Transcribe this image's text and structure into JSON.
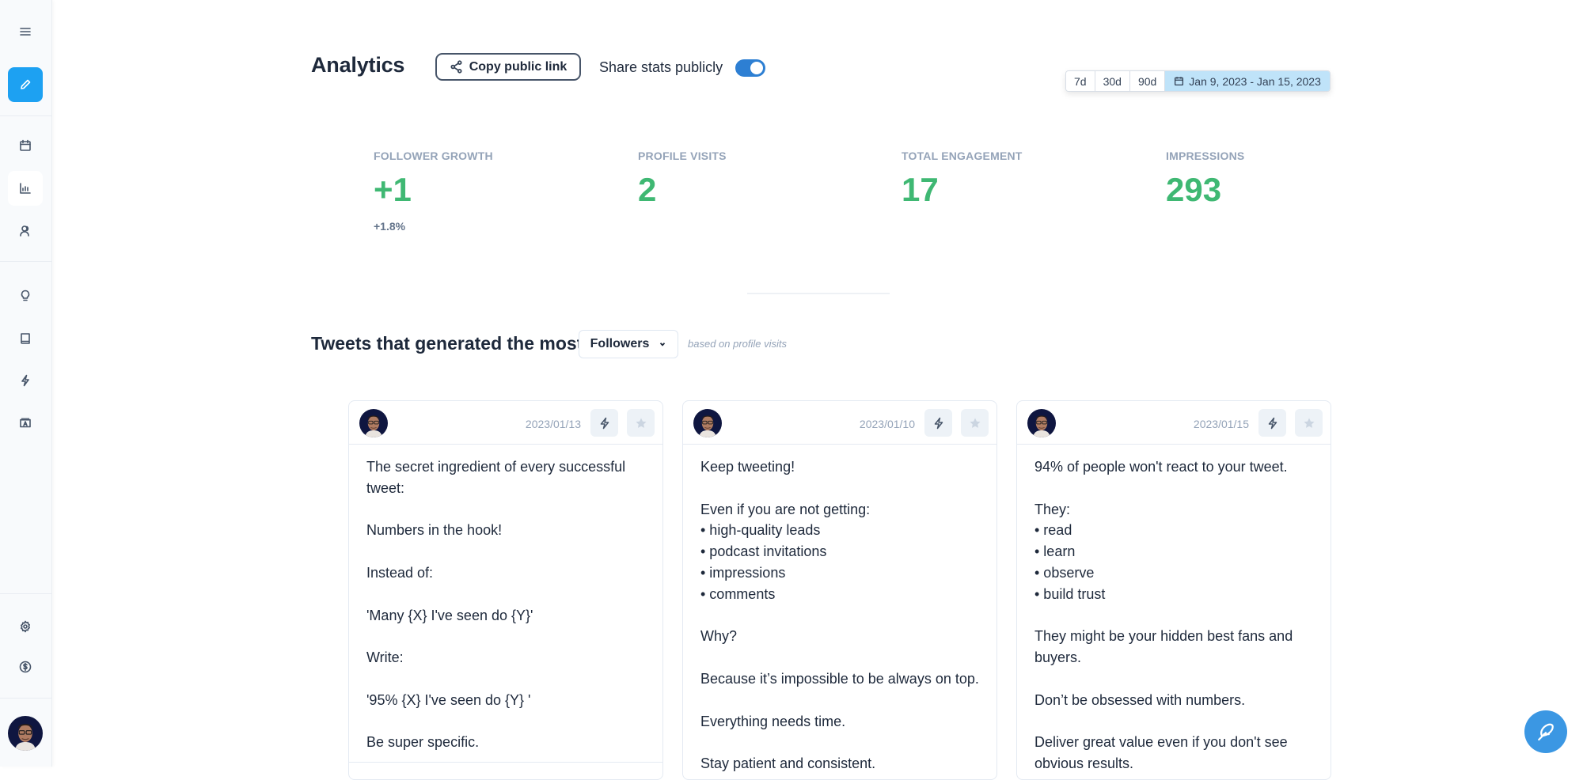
{
  "sidebar": {
    "items": [
      {
        "name": "menu",
        "icon": "hamburger-menu-icon"
      },
      {
        "name": "compose",
        "icon": "pencil-icon"
      },
      {
        "name": "calendar",
        "icon": "calendar-icon"
      },
      {
        "name": "analytics",
        "icon": "bar-chart-icon",
        "active": true
      },
      {
        "name": "audience",
        "icon": "users-icon"
      },
      {
        "name": "inspiration",
        "icon": "lightbulb-icon"
      },
      {
        "name": "library",
        "icon": "book-icon"
      },
      {
        "name": "automation",
        "icon": "lightning-icon"
      },
      {
        "name": "templates",
        "icon": "template-icon"
      },
      {
        "name": "settings",
        "icon": "gear-icon"
      },
      {
        "name": "billing",
        "icon": "dollar-circle-icon"
      }
    ],
    "avatar": "user-avatar"
  },
  "header": {
    "title": "Analytics",
    "copy_link_label": "Copy public link",
    "share_label": "Share stats publicly",
    "share_enabled": true
  },
  "date_range": {
    "options": [
      "7d",
      "30d",
      "90d"
    ],
    "selected_range": "Jan 9, 2023 - Jan 15, 2023"
  },
  "stats": [
    {
      "label": "FOLLOWER GROWTH",
      "value": "+1",
      "sub": "+1.8%"
    },
    {
      "label": "PROFILE VISITS",
      "value": "2",
      "sub": ""
    },
    {
      "label": "TOTAL ENGAGEMENT",
      "value": "17",
      "sub": ""
    },
    {
      "label": "IMPRESSIONS",
      "value": "293",
      "sub": ""
    }
  ],
  "tweets_section": {
    "title": "Tweets that generated the most",
    "metric_selected": "Followers",
    "note": "based on profile visits"
  },
  "tweets": [
    {
      "date": "2023/01/13",
      "text": "The secret ingredient of every successful tweet:\n\nNumbers in the hook!\n\nInstead of:\n\n'Many {X} I've seen do {Y}'\n\nWrite:\n\n'95% {X} I've seen do {Y} '\n\nBe super specific."
    },
    {
      "date": "2023/01/10",
      "text": "Keep tweeting!\n\nEven if you are not getting:\n• high-quality leads\n• podcast invitations\n• impressions\n• comments\n\nWhy?\n\nBecause it’s impossible to be always on top.\n\nEverything needs time.\n\nStay patient and consistent."
    },
    {
      "date": "2023/01/15",
      "text": "94% of people won't react to your tweet.\n\nThey:\n• read\n• learn\n• observe\n• build trust\n\nThey might be your hidden best fans and buyers.\n\nDon’t be obsessed with numbers.\n\nDeliver great value even if you don't see obvious results."
    }
  ],
  "colors": {
    "accent": "#1da1f2",
    "toggle_on": "#2d7fd3",
    "stat_value": "#3fb873",
    "date_selected_bg": "#bfe3f9",
    "fab": "#3b97e3"
  }
}
